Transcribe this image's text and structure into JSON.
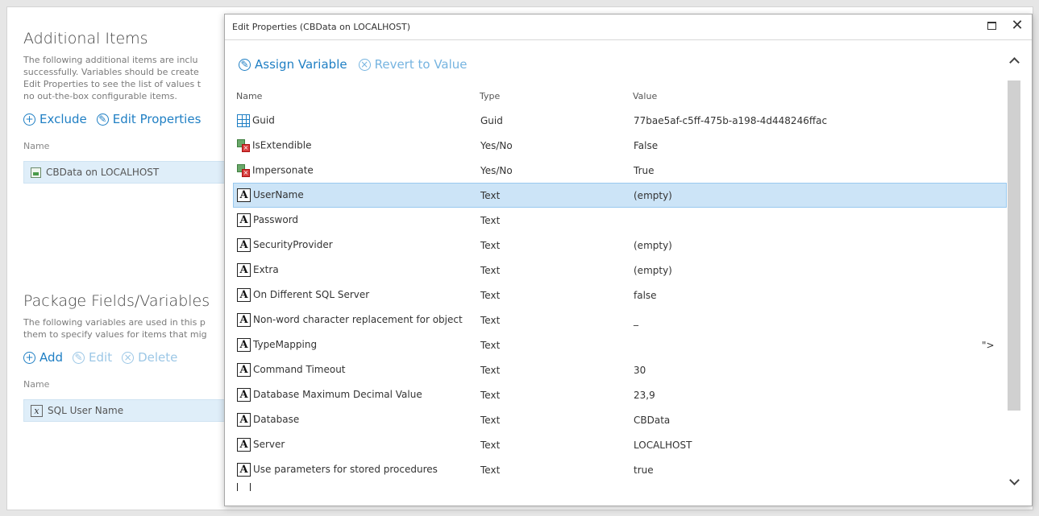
{
  "background": {
    "additional_items": {
      "title": "Additional Items",
      "description_lines": [
        "The following additional items are inclu",
        "successfully. Variables should be create",
        "Edit Properties to see the list of values t",
        "no out-the-box configurable items."
      ],
      "actions": {
        "exclude": "Exclude",
        "edit_properties": "Edit Properties"
      },
      "column_name": "Name",
      "row_label": "CBData on LOCALHOST"
    },
    "package_fields": {
      "title": "Package Fields/Variables",
      "description_lines": [
        "The following variables are used in this p",
        "them to specify values for items that mig"
      ],
      "actions": {
        "add": "Add",
        "edit": "Edit",
        "delete": "Delete"
      },
      "column_name": "Name",
      "row_label": "SQL User Name"
    }
  },
  "modal": {
    "title": "Edit Properties (CBData on LOCALHOST)",
    "toolbar": {
      "assign_variable": "Assign Variable",
      "revert_to_value": "Revert to Value"
    },
    "columns": {
      "name": "Name",
      "type": "Type",
      "value": "Value"
    },
    "rows": [
      {
        "icon": "grid-icon",
        "name": "Guid",
        "type": "Guid",
        "value": "77bae5af-c5ff-475b-a198-4d448246ffac"
      },
      {
        "icon": "boolean-icon",
        "name": "IsExtendible",
        "type": "Yes/No",
        "value": "False"
      },
      {
        "icon": "boolean-icon",
        "name": "Impersonate",
        "type": "Yes/No",
        "value": "True"
      },
      {
        "icon": "text-icon",
        "name": "UserName",
        "type": "Text",
        "value": "(empty)",
        "selected": true
      },
      {
        "icon": "text-icon",
        "name": "Password",
        "type": "Text",
        "value": ""
      },
      {
        "icon": "text-icon",
        "name": "SecurityProvider",
        "type": "Text",
        "value": "(empty)"
      },
      {
        "icon": "text-icon",
        "name": "Extra",
        "type": "Text",
        "value": "(empty)"
      },
      {
        "icon": "text-icon",
        "name": "On Different SQL Server",
        "type": "Text",
        "value": "false"
      },
      {
        "icon": "text-icon",
        "name": "Non-word character replacement for object",
        "type": "Text",
        "value": "_"
      },
      {
        "icon": "text-icon",
        "name": "TypeMapping",
        "type": "Text",
        "value": "\">"
      },
      {
        "icon": "text-icon",
        "name": "Command Timeout",
        "type": "Text",
        "value": "30"
      },
      {
        "icon": "text-icon",
        "name": "Database Maximum Decimal Value",
        "type": "Text",
        "value": "23,9"
      },
      {
        "icon": "text-icon",
        "name": "Database",
        "type": "Text",
        "value": "CBData"
      },
      {
        "icon": "text-icon",
        "name": "Server",
        "type": "Text",
        "value": "LOCALHOST"
      },
      {
        "icon": "text-icon",
        "name": "Use parameters for stored procedures",
        "type": "Text",
        "value": "true"
      }
    ]
  },
  "colors": {
    "accent": "#1f7fc4",
    "selected_row": "#cce4f7"
  }
}
